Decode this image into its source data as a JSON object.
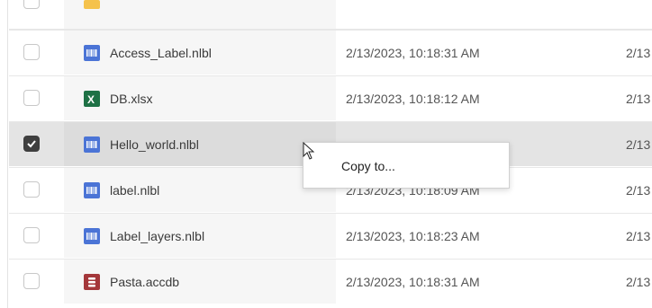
{
  "files": [
    {
      "name": "Access_Label.nlbl",
      "modified": "2/13/2023, 10:18:31 AM",
      "modified2": "2/13",
      "icon": "nlbl-file-icon",
      "checked": false
    },
    {
      "name": "DB.xlsx",
      "modified": "2/13/2023, 10:18:12 AM",
      "modified2": "2/13",
      "icon": "excel-file-icon",
      "checked": false
    },
    {
      "name": "Hello_world.nlbl",
      "modified": "",
      "modified2": "2/13",
      "icon": "nlbl-file-icon",
      "checked": true
    },
    {
      "name": "label.nlbl",
      "modified": "2/13/2023, 10:18:09 AM",
      "modified2": "2/13",
      "icon": "nlbl-file-icon",
      "checked": false
    },
    {
      "name": "Label_layers.nlbl",
      "modified": "2/13/2023, 10:18:23 AM",
      "modified2": "2/13",
      "icon": "nlbl-file-icon",
      "checked": false
    },
    {
      "name": "Pasta.accdb",
      "modified": "2/13/2023, 10:18:31 AM",
      "modified2": "2/13",
      "icon": "access-file-icon",
      "checked": false
    }
  ],
  "context_menu": {
    "items": [
      {
        "label": "Copy to..."
      }
    ]
  },
  "colors": {
    "nlbl": "#4b74d6",
    "excel": "#1e7145",
    "access": "#a4373a",
    "selected_row": "#e4e4e4"
  }
}
